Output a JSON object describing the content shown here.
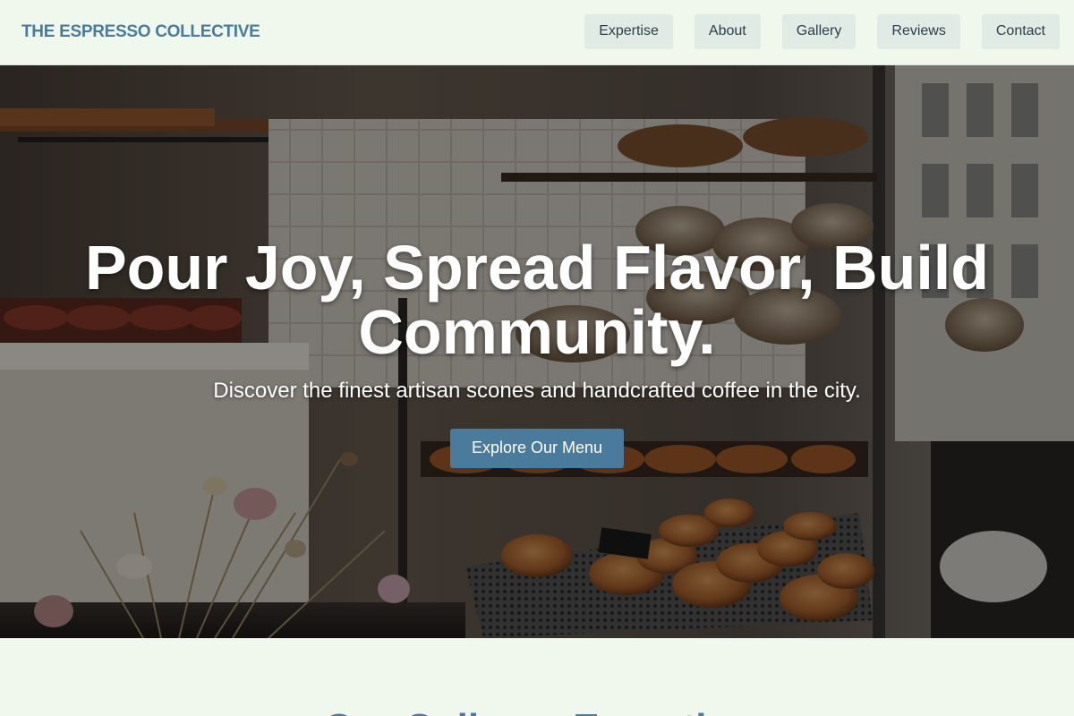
{
  "header": {
    "brand": "THE ESPRESSO COLLECTIVE",
    "nav": [
      {
        "label": "Expertise"
      },
      {
        "label": "About"
      },
      {
        "label": "Gallery"
      },
      {
        "label": "Reviews"
      },
      {
        "label": "Contact"
      }
    ]
  },
  "hero": {
    "title": "Pour Joy, Spread Flavor, Build Community.",
    "subtitle": "Discover the finest artisan scones and handcrafted coffee in the city.",
    "cta_label": "Explore Our Menu",
    "image_description": "bakery display case with pastries and dried flowers"
  },
  "next_section": {
    "title": "Our Culinary Expertise"
  },
  "colors": {
    "page_background": "#f0f8ee",
    "brand": "#4a7a9c",
    "nav_button_bg": "#e0ebe6",
    "cta_bg": "#4a7a9c"
  }
}
